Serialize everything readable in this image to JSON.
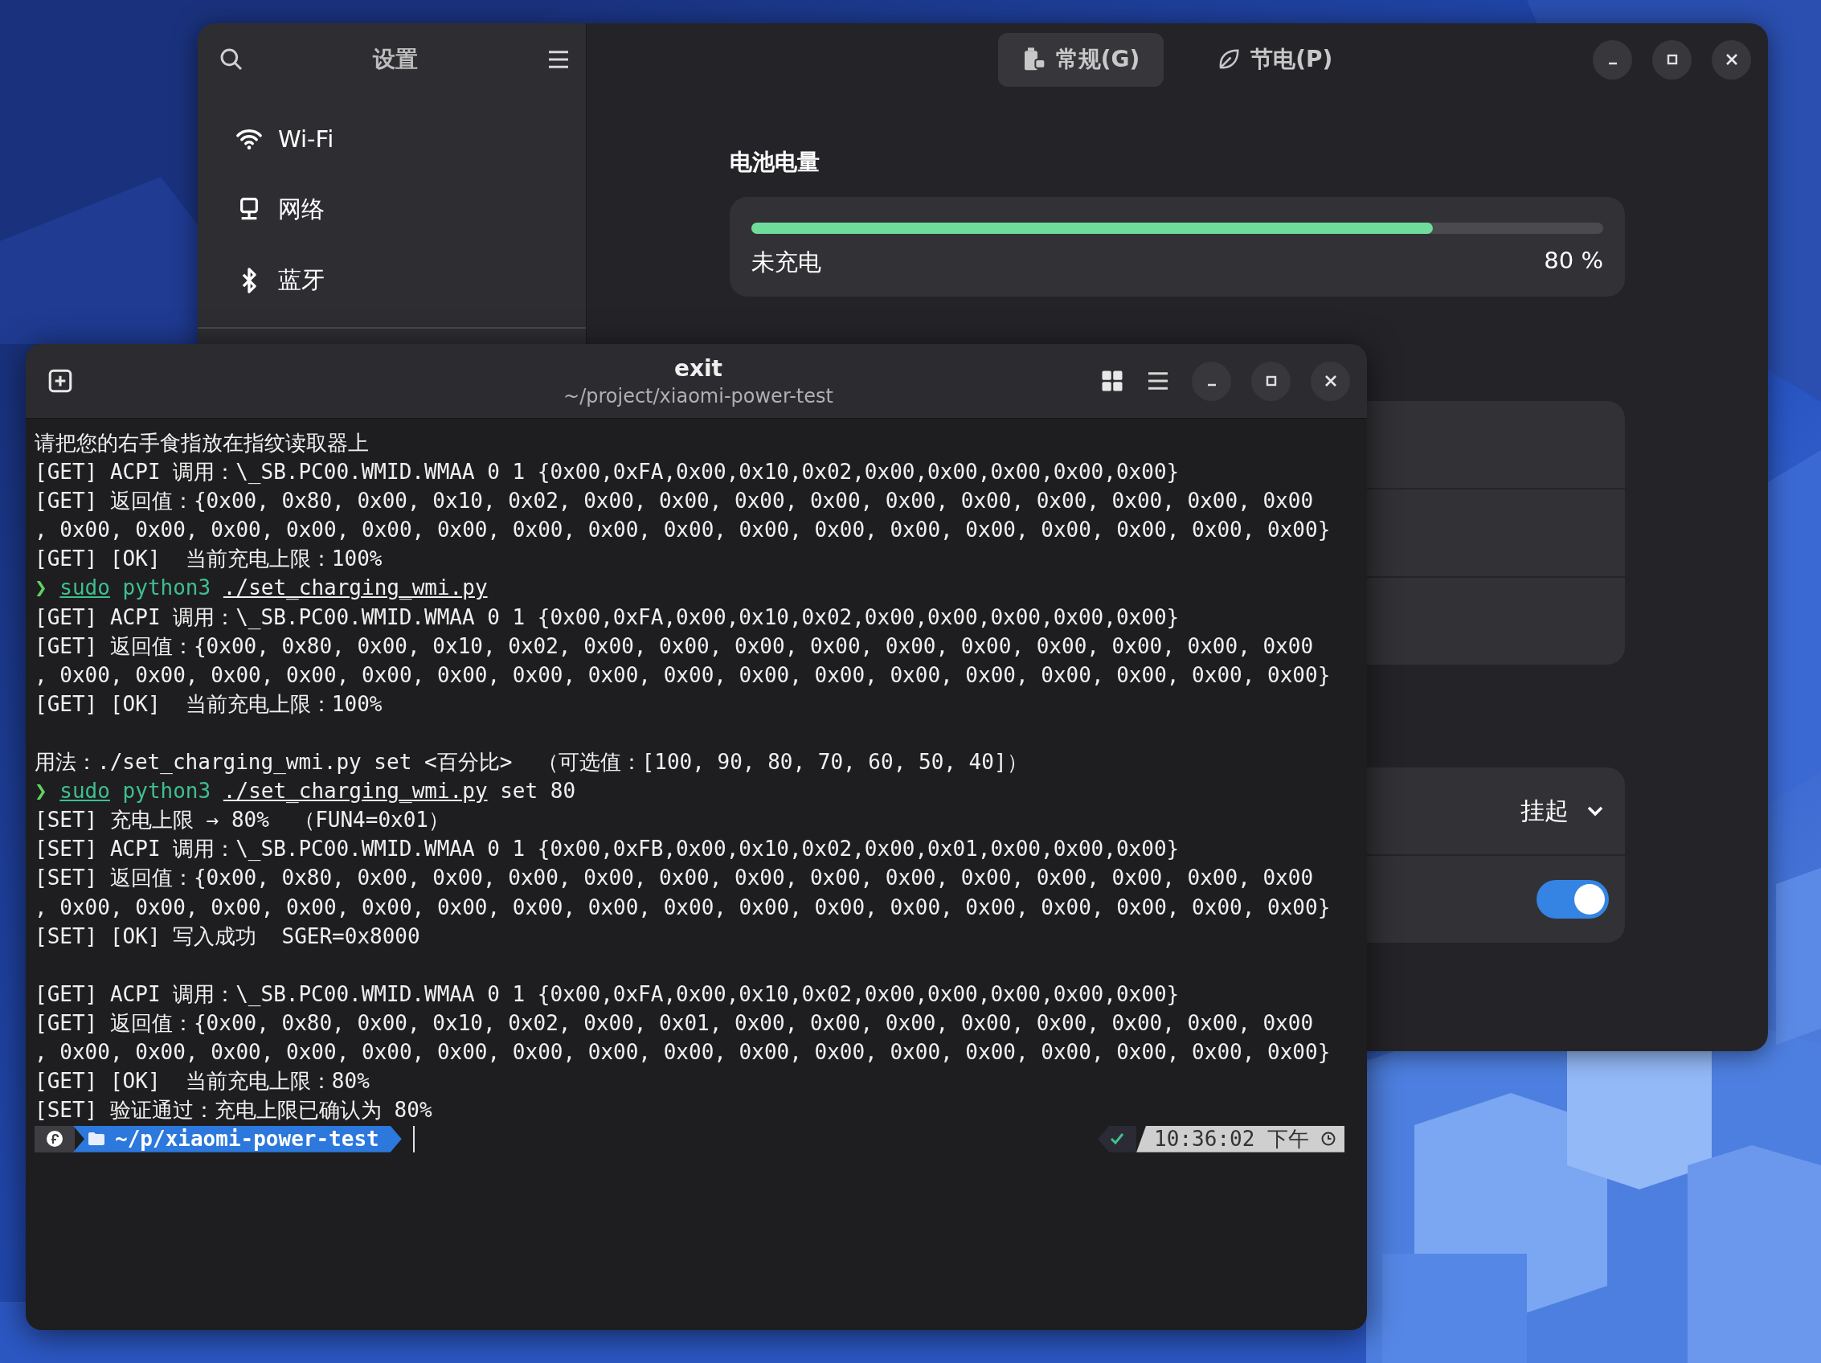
{
  "settings_window": {
    "sidebar": {
      "title": "设置",
      "items": [
        {
          "label": "Wi-Fi",
          "selected": false
        },
        {
          "label": "网络",
          "selected": false
        },
        {
          "label": "蓝牙",
          "selected": false
        }
      ]
    },
    "tabs": [
      {
        "label": "常规(G)",
        "selected": true
      },
      {
        "label": "节电(P)",
        "selected": false
      }
    ],
    "battery": {
      "heading": "电池电量",
      "level": 0.8,
      "status": "未充电",
      "percent": "80 %"
    },
    "suspend_dropdown": {
      "value": "挂起"
    },
    "toggle": {
      "on": true
    }
  },
  "terminal": {
    "title": "exit",
    "subtitle": "~/project/xiaomi-power-test",
    "lines": [
      {
        "kind": "output",
        "text": "请把您的右手食指放在指纹读取器上"
      },
      {
        "kind": "output",
        "text": "[GET] ACPI 调用：\\_SB.PC00.WMID.WMAA 0 1 {0x00,0xFA,0x00,0x10,0x02,0x00,0x00,0x00,0x00,0x00}"
      },
      {
        "kind": "output",
        "text": "[GET] 返回值：{0x00, 0x80, 0x00, 0x10, 0x02, 0x00, 0x00, 0x00, 0x00, 0x00, 0x00, 0x00, 0x00, 0x00, 0x00"
      },
      {
        "kind": "output",
        "text": ", 0x00, 0x00, 0x00, 0x00, 0x00, 0x00, 0x00, 0x00, 0x00, 0x00, 0x00, 0x00, 0x00, 0x00, 0x00, 0x00, 0x00}"
      },
      {
        "kind": "output",
        "text": "[GET] [OK]  当前充电上限：100%"
      },
      {
        "kind": "command",
        "prompt": "❯",
        "sudo": "sudo",
        "program": "python3",
        "script": "./set_charging_wmi.py"
      },
      {
        "kind": "output",
        "text": "[GET] ACPI 调用：\\_SB.PC00.WMID.WMAA 0 1 {0x00,0xFA,0x00,0x10,0x02,0x00,0x00,0x00,0x00,0x00}"
      },
      {
        "kind": "output",
        "text": "[GET] 返回值：{0x00, 0x80, 0x00, 0x10, 0x02, 0x00, 0x00, 0x00, 0x00, 0x00, 0x00, 0x00, 0x00, 0x00, 0x00"
      },
      {
        "kind": "output",
        "text": ", 0x00, 0x00, 0x00, 0x00, 0x00, 0x00, 0x00, 0x00, 0x00, 0x00, 0x00, 0x00, 0x00, 0x00, 0x00, 0x00, 0x00}"
      },
      {
        "kind": "output",
        "text": "[GET] [OK]  当前充电上限：100%"
      },
      {
        "kind": "blank"
      },
      {
        "kind": "output",
        "text": "用法：./set_charging_wmi.py set <百分比>  （可选值：[100, 90, 80, 70, 60, 50, 40]）"
      },
      {
        "kind": "command",
        "prompt": "❯",
        "sudo": "sudo",
        "program": "python3",
        "script": "./set_charging_wmi.py",
        "args": "set 80"
      },
      {
        "kind": "output",
        "text": "[SET] 充电上限 → 80%  （FUN4=0x01）"
      },
      {
        "kind": "output",
        "text": "[SET] ACPI 调用：\\_SB.PC00.WMID.WMAA 0 1 {0x00,0xFB,0x00,0x10,0x02,0x00,0x01,0x00,0x00,0x00}"
      },
      {
        "kind": "output",
        "text": "[SET] 返回值：{0x00, 0x80, 0x00, 0x00, 0x00, 0x00, 0x00, 0x00, 0x00, 0x00, 0x00, 0x00, 0x00, 0x00, 0x00"
      },
      {
        "kind": "output",
        "text": ", 0x00, 0x00, 0x00, 0x00, 0x00, 0x00, 0x00, 0x00, 0x00, 0x00, 0x00, 0x00, 0x00, 0x00, 0x00, 0x00, 0x00}"
      },
      {
        "kind": "output",
        "text": "[SET] [OK] 写入成功  SGER=0x8000"
      },
      {
        "kind": "blank"
      },
      {
        "kind": "output",
        "text": "[GET] ACPI 调用：\\_SB.PC00.WMID.WMAA 0 1 {0x00,0xFA,0x00,0x10,0x02,0x00,0x00,0x00,0x00,0x00}"
      },
      {
        "kind": "output",
        "text": "[GET] 返回值：{0x00, 0x80, 0x00, 0x10, 0x02, 0x00, 0x01, 0x00, 0x00, 0x00, 0x00, 0x00, 0x00, 0x00, 0x00"
      },
      {
        "kind": "output",
        "text": ", 0x00, 0x00, 0x00, 0x00, 0x00, 0x00, 0x00, 0x00, 0x00, 0x00, 0x00, 0x00, 0x00, 0x00, 0x00, 0x00, 0x00}"
      },
      {
        "kind": "output",
        "text": "[GET] [OK]  当前充电上限：80%"
      },
      {
        "kind": "output",
        "text": "[SET] 验证通过：充电上限已确认为 80%"
      }
    ],
    "prompt": {
      "path": "~/p/**xiaomi-power-test**",
      "last_command_ok": true,
      "time": "10:36:02 下午"
    }
  }
}
